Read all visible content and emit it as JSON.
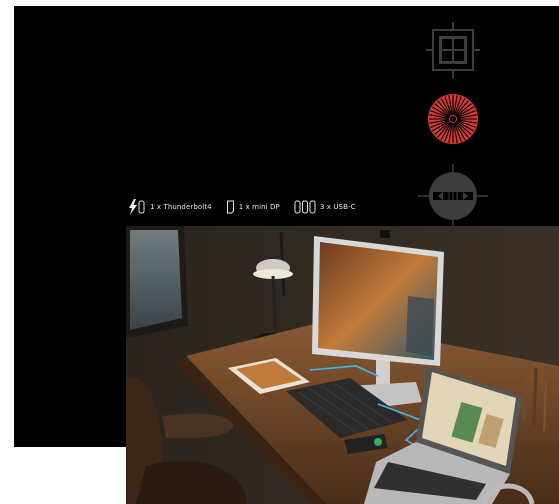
{
  "ports": {
    "thunderbolt": {
      "label": "1 x Thunderbolt4",
      "icon": "thunderbolt-icon"
    },
    "minidp": {
      "label": "1 x mini DP",
      "icon": "mini-dp-port-icon"
    },
    "usbc": {
      "label": "3 x USB-C",
      "icon": "usb-c-port-icon"
    }
  },
  "feature_icons": [
    "grid-focus-icon",
    "radial-burst-icon",
    "crosshair-icon"
  ],
  "colors": {
    "panel": "#000000",
    "burst": "#d23a32",
    "icon_gray": "#3d3d3d",
    "connector_line": "#3fb7e8"
  }
}
